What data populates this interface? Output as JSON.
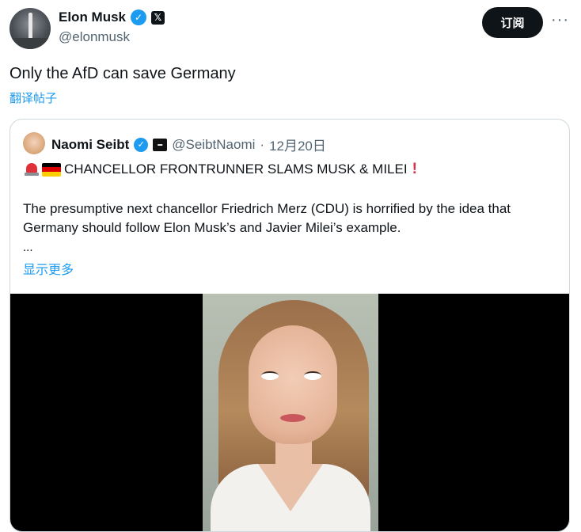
{
  "post": {
    "author": {
      "name": "Elon Musk",
      "handle": "@elonmusk",
      "verified_icon": "verified-badge-icon",
      "affiliation_icon": "x-logo-icon"
    },
    "subscribe_label": "订阅",
    "more_label": "···",
    "text": "Only the AfD can save Germany",
    "translate_label": "翻译帖子"
  },
  "quoted": {
    "author": {
      "name": "Naomi Seibt",
      "handle": "@SeibtNaomi",
      "separator": "·",
      "date": "12月20日"
    },
    "headline": "CHANCELLOR FRONTRUNNER SLAMS MUSK & MILEI",
    "headline_icons": [
      "siren-icon",
      "flag-germany-icon",
      "exclamation-icon"
    ],
    "body": "The presumptive next chancellor Friedrich Merz (CDU) is horrified by the idea that Germany should follow Elon Musk’s and Javier Milei’s example.",
    "ellipsis": "...",
    "show_more_label": "显示更多",
    "media": {
      "kind": "video-thumbnail"
    }
  },
  "colors": {
    "accent": "#1d9bf0",
    "text": "#0f1419",
    "muted": "#536471",
    "border": "#cfd9de",
    "flag": [
      "#000000",
      "#dd0000",
      "#ffce00"
    ]
  }
}
